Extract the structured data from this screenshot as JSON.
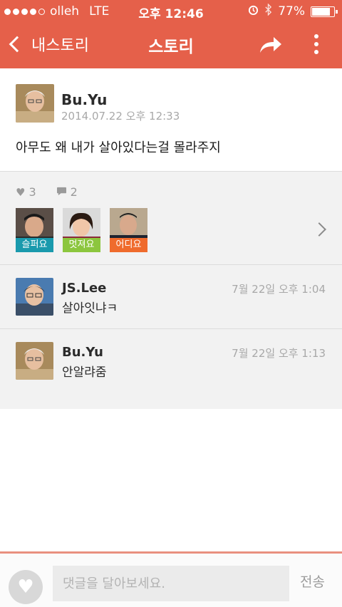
{
  "status_bar": {
    "carrier": "olleh",
    "network": "LTE",
    "time": "오후 12:46",
    "battery": "77%",
    "battery_level": 0.77,
    "icons": [
      "alarm-icon",
      "bluetooth-icon",
      "battery-icon"
    ]
  },
  "nav": {
    "back_label": "내스토리",
    "title": "스토리",
    "icons": [
      "chevron-left-icon",
      "share-icon",
      "more-icon"
    ]
  },
  "post": {
    "author": "Bu.Yu",
    "date": "2014.07.22 오후 12:33",
    "text": "아무도 왜 내가 살아있다는걸 몰라주지",
    "likes": "3",
    "comments_count": "2"
  },
  "emotions": [
    {
      "label": "슬퍼요",
      "color": "#1a9aad"
    },
    {
      "label": "멋져요",
      "color": "#8cc63e"
    },
    {
      "label": "어디요",
      "color": "#ef6b2d"
    }
  ],
  "comments": [
    {
      "name": "JS.Lee",
      "time": "7월 22일 오후 1:04",
      "text": "살아잇냐ㅋ"
    },
    {
      "name": "Bu.Yu",
      "time": "7월 22일 오후 1:13",
      "text": "안알랴줌"
    }
  ],
  "input": {
    "placeholder": "댓글을 달아보세요.",
    "send_label": "전송"
  },
  "colors": {
    "header": "#e5604a",
    "accent_line": "#e9907f",
    "background_gray": "#f2f2f2"
  }
}
